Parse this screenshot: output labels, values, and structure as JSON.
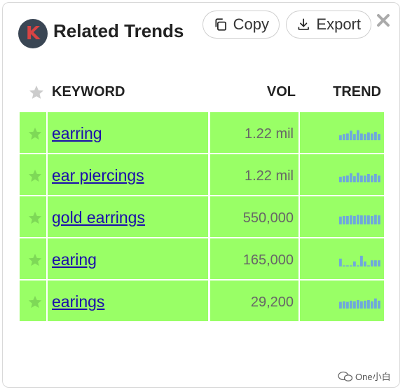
{
  "header": {
    "logo_letter": "K",
    "title": "Related Trends",
    "copy_label": "Copy",
    "export_label": "Export",
    "close_icon": "close-icon"
  },
  "table": {
    "columns": {
      "keyword": "KEYWORD",
      "vol": "VOL",
      "trend": "TREND"
    },
    "rows": [
      {
        "keyword": "earring",
        "vol": "1.22 mil",
        "trend": [
          0.45,
          0.55,
          0.6,
          0.85,
          0.55,
          0.9,
          0.6,
          0.55,
          0.7,
          0.6,
          0.75,
          0.55
        ]
      },
      {
        "keyword": "ear piercings",
        "vol": "1.22 mil",
        "trend": [
          0.5,
          0.55,
          0.6,
          0.8,
          0.55,
          0.85,
          0.6,
          0.6,
          0.75,
          0.6,
          0.75,
          0.6
        ]
      },
      {
        "keyword": "gold earrings",
        "vol": "550,000",
        "trend": [
          0.7,
          0.75,
          0.75,
          0.8,
          0.75,
          0.85,
          0.8,
          0.8,
          0.8,
          0.75,
          0.85,
          0.8
        ]
      },
      {
        "keyword": "earing",
        "vol": "165,000",
        "trend": [
          0.7,
          0.1,
          0.1,
          0.1,
          0.45,
          0.1,
          0.95,
          0.45,
          0.1,
          0.55,
          0.55,
          0.55
        ]
      },
      {
        "keyword": "earings",
        "vol": "29,200",
        "trend": [
          0.6,
          0.65,
          0.6,
          0.7,
          0.65,
          0.75,
          0.65,
          0.7,
          0.75,
          0.65,
          0.9,
          0.7
        ]
      }
    ]
  },
  "colors": {
    "row_bg": "#99ff66",
    "star_filled": "#7ed957",
    "star_header": "#cccccc",
    "link": "#1a0dab",
    "spark": "#6fa8dc"
  },
  "watermark": "One小白"
}
